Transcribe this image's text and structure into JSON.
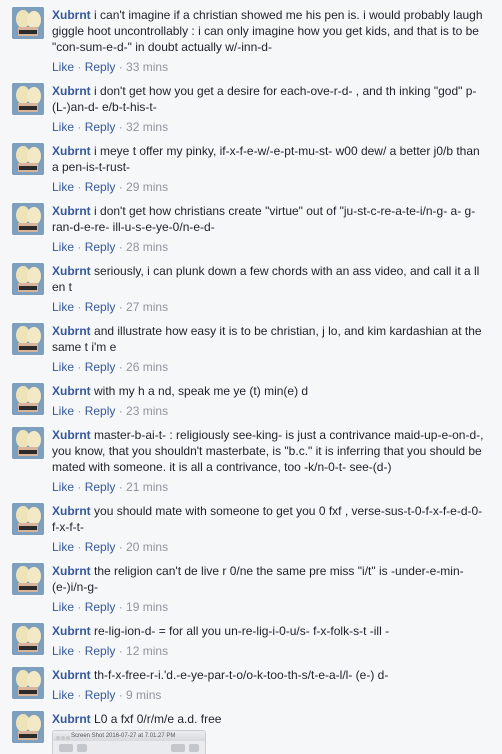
{
  "comments": [
    {
      "author": "Xubrnt",
      "text": "i can't imagine if a christian showed me his pen is. i would probably laugh giggle hoot uncontrollably : i can only imagine how you get kids, and that is to be \"con-sum-e-d-\" in doubt actually w/-inn-d-",
      "like": "Like",
      "reply": "Reply",
      "time": "33 mins"
    },
    {
      "author": "Xubrnt",
      "text": "i don't get how you get a desire for each-ove-r-d- , and th inking \"god\" p-(L-)an-d- e/b-t-his-t-",
      "like": "Like",
      "reply": "Reply",
      "time": "32 mins"
    },
    {
      "author": "Xubrnt",
      "text": "i meye t offer my pinky, if-x-f-e-w/-e-pt-mu-st- w00 dew/ a better j0/b than a pen-is-t-rust-",
      "like": "Like",
      "reply": "Reply",
      "time": "29 mins"
    },
    {
      "author": "Xubrnt",
      "text": "i don't get how christians create \"virtue\" out of \"ju-st-c-re-a-te-i/n-g- a- g-ran-d-e-re- ill-u-s-e-ye-0/n-e-d-",
      "like": "Like",
      "reply": "Reply",
      "time": "28 mins"
    },
    {
      "author": "Xubrnt",
      "text": "seriously, i can plunk down a few chords with an ass video, and call it a ll en t",
      "like": "Like",
      "reply": "Reply",
      "time": "27 mins"
    },
    {
      "author": "Xubrnt",
      "text": "and illustrate how easy it is to be christian, j lo, and kim kardashian at the same t i'm e",
      "like": "Like",
      "reply": "Reply",
      "time": "26 mins"
    },
    {
      "author": "Xubrnt",
      "text": "with my h a nd, speak me ye (t) min(e) d",
      "like": "Like",
      "reply": "Reply",
      "time": "23 mins"
    },
    {
      "author": "Xubrnt",
      "text": "master-b-ai-t- : religiously see-king- is just a contrivance maid-up-e-on-d-, you know, that you shouldn't masterbate, is \"b.c.\" it is inferring that you should be mated with someone. it is all a contrivance, too -k/n-0-t- see-(d-)",
      "like": "Like",
      "reply": "Reply",
      "time": "21 mins"
    },
    {
      "author": "Xubrnt",
      "text": "you should mate with someone to get you 0 fxf , verse-sus-t-0-f-x-f-e-d-0-f-x-f-t-",
      "like": "Like",
      "reply": "Reply",
      "time": "20 mins"
    },
    {
      "author": "Xubrnt",
      "text": "the religion can't de live r 0/ne the same pre miss \"i/t\" is -under-e-min-(e-)i/n-g-",
      "like": "Like",
      "reply": "Reply",
      "time": "19 mins"
    },
    {
      "author": "Xubrnt",
      "text": "re-lig-ion-d- = for all you un-re-lig-i-0-u/s- f-x-folk-s-t -ill -",
      "like": "Like",
      "reply": "Reply",
      "time": "12 mins"
    },
    {
      "author": "Xubrnt",
      "text": "th-f-x-free-r-i.'d.-e-ye-par-t-o/o-k-too-th-s/t-e-a-l/l- (e-) d-",
      "like": "Like",
      "reply": "Reply",
      "time": "9 mins"
    },
    {
      "author": "Xubrnt",
      "text": "L0 a fxf 0/r/m/e a.d. free"
    }
  ],
  "attachment": {
    "caption": "Screen Shot 2016-07-27 at 7.01.27 PM"
  },
  "colors": {
    "link": "#365899",
    "text": "#1d2129",
    "meta": "#90949c",
    "background": "#f6f7f9"
  }
}
